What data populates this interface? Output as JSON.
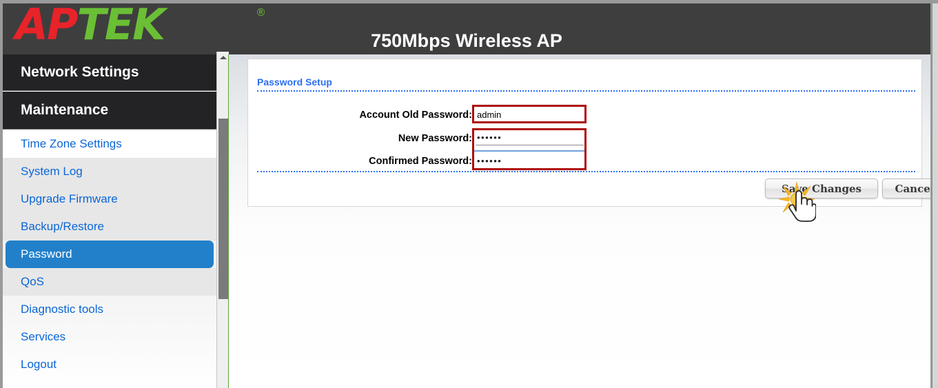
{
  "window": {
    "header_title": "750Mbps Wireless AP",
    "logo": {
      "part_red": "AP",
      "part_green": "TEK",
      "registered_mark": "®",
      "colors": {
        "red": "#e8232a",
        "green": "#6abf35",
        "bar": "#3e3e3e"
      }
    }
  },
  "sidebar": {
    "groups": [
      {
        "label": "Network Settings"
      },
      {
        "label": "Maintenance"
      }
    ],
    "items": [
      {
        "label": "Time Zone Settings",
        "shade": "white",
        "active": false
      },
      {
        "label": "System Log",
        "shade": "grey",
        "active": false
      },
      {
        "label": "Upgrade Firmware",
        "shade": "grey",
        "active": false
      },
      {
        "label": "Backup/Restore",
        "shade": "grey",
        "active": false
      },
      {
        "label": "Password",
        "shade": "grey",
        "active": true
      },
      {
        "label": "QoS",
        "shade": "grey",
        "active": false
      },
      {
        "label": "Diagnostic tools",
        "shade": "white",
        "active": false
      },
      {
        "label": "Services",
        "shade": "white",
        "active": false
      },
      {
        "label": "Logout",
        "shade": "white",
        "active": false
      }
    ],
    "scrollbar": {
      "up_arrow": "scroll-up-arrow"
    },
    "link_color": "#0a66d6",
    "active_color": "#2280ca"
  },
  "content": {
    "section_title": "Password Setup",
    "fields": [
      {
        "label": "Account Old Password:",
        "value": "admin",
        "masked": false,
        "placeholder": ""
      },
      {
        "label": "New Password:",
        "value": "••••••",
        "masked": true,
        "placeholder": ""
      },
      {
        "label": "Confirmed Password:",
        "value": "••••••",
        "masked": true,
        "placeholder": ""
      }
    ],
    "buttons": [
      {
        "label": "Save Changes"
      },
      {
        "label": "Cancel"
      }
    ],
    "highlight_color": "#ad0b0b"
  },
  "cursor": {
    "pointer": "hand-pointer-cursor",
    "click_effect": "click-burst-icon"
  }
}
